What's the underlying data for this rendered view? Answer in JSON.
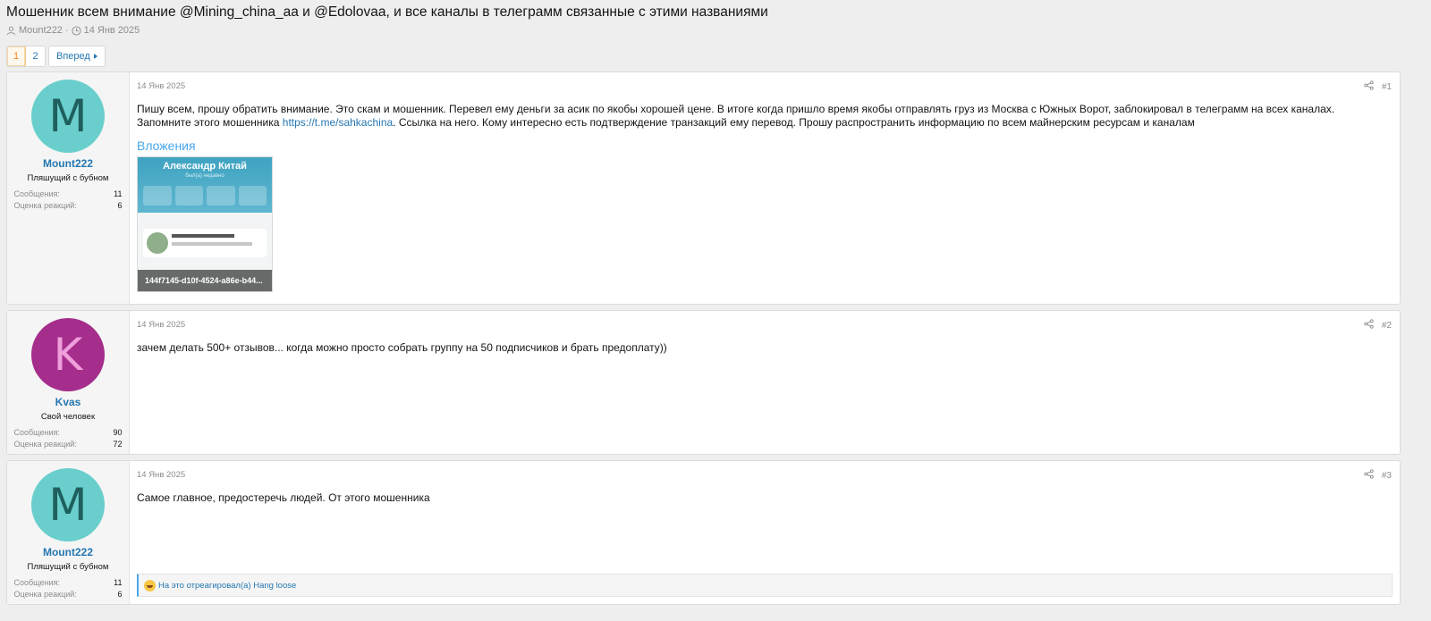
{
  "thread": {
    "title": "Мошенник всем внимание @Mining_china_aa и @Edolovaa, и все каналы в телеграмм связанные с этими названиями",
    "author": "Mount222",
    "separator": "·",
    "date": "14 Янв 2025"
  },
  "pager": {
    "pages": [
      "1",
      "2"
    ],
    "current": "1",
    "next_label": "Вперед"
  },
  "posts": [
    {
      "user": {
        "avatar_letter": "M",
        "avatar_bg": "#6acfcc",
        "avatar_fg": "#1e5f5d",
        "name": "Mount222",
        "title": "Пляшущий с бубном",
        "stats": [
          {
            "label": "Сообщения:",
            "value": "11"
          },
          {
            "label": "Оценка реакций:",
            "value": "6"
          }
        ]
      },
      "date": "14 Янв 2025",
      "number": "#1",
      "body_pre": "Пишу всем, прошу обратить внимание. Это скам и мошенник. Перевел ему деньги за асик по якобы хорошей цене. В итоге когда пришло время якобы отправлять груз из Москва с Южных Ворот, заблокировал в телеграмм на всех каналах. Запомните этого мошенника ",
      "body_link": "https://t.me/sahkachina",
      "body_post": ". Ссылка на него. Кому интересно есть подтверждение транзакций ему перевод. Прошу распространить информацию по всем майнерским ресурсам и каналам",
      "attachments_title": "Вложения",
      "attachment": {
        "caption": "144f7145-d10f-4524-a86e-b44...",
        "image_name": "Александр Китай",
        "image_sub": "был(а) недавно"
      }
    },
    {
      "user": {
        "avatar_letter": "K",
        "avatar_bg": "#a52d8c",
        "avatar_fg": "#ef9fdc",
        "name": "Kvas",
        "title": "Свой человек",
        "stats": [
          {
            "label": "Сообщения:",
            "value": "90"
          },
          {
            "label": "Оценка реакций:",
            "value": "72"
          }
        ]
      },
      "date": "14 Янв 2025",
      "number": "#2",
      "body": "зачем делать 500+ отзывов... когда можно просто собрать группу на 50 подписчиков и брать предоплату))"
    },
    {
      "user": {
        "avatar_letter": "M",
        "avatar_bg": "#6acfcc",
        "avatar_fg": "#1e5f5d",
        "name": "Mount222",
        "title": "Пляшущий с бубном",
        "stats": [
          {
            "label": "Сообщения:",
            "value": "11"
          },
          {
            "label": "Оценка реакций:",
            "value": "6"
          }
        ]
      },
      "date": "14 Янв 2025",
      "number": "#3",
      "body": "Самое главное, предостеречь людей. От этого мошенника",
      "reaction_text": "На это отреагировал(а) Hang loose"
    }
  ],
  "icons": {
    "author": "user-icon",
    "date": "clock-icon",
    "share": "share-icon",
    "next": "caret-right-icon",
    "reaction": "laughing-emoji-icon"
  }
}
